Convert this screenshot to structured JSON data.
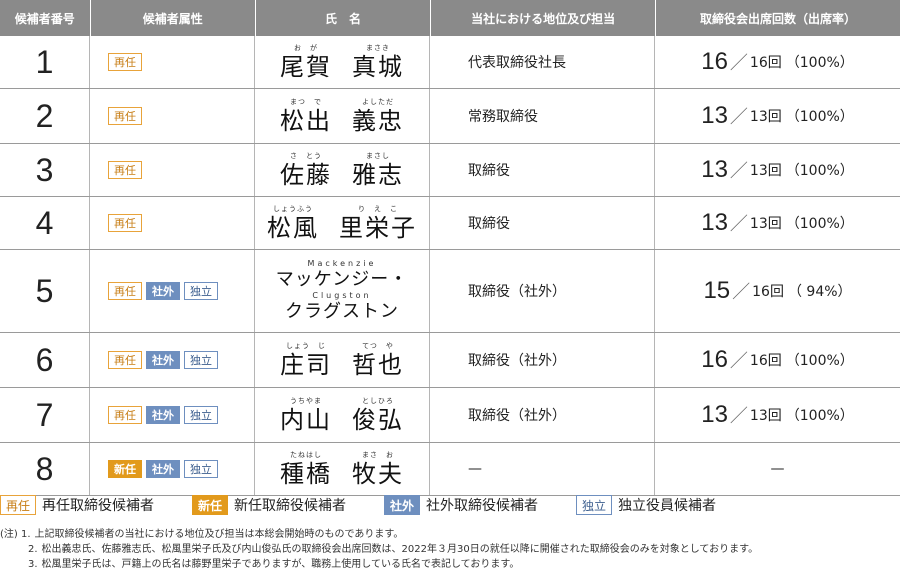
{
  "headers": [
    "候補者番号",
    "候補者属性",
    "氏　名",
    "当社における地位及び担当",
    "取締役会出席回数（出席率）"
  ],
  "candidates": [
    {
      "num": "1",
      "badges": [
        {
          "label": "再任",
          "kind": "reelect"
        }
      ],
      "ruby1": "お　が",
      "kanji1": "尾賀",
      "ruby2": "まさき",
      "kanji2": "真城",
      "position": "代表取締役社長",
      "att_a": "16",
      "att_b": "16回",
      "att_rate": "（100%）"
    },
    {
      "num": "2",
      "badges": [
        {
          "label": "再任",
          "kind": "reelect"
        }
      ],
      "ruby1": "まつ　で",
      "kanji1": "松出",
      "ruby2": "よしただ",
      "kanji2": "義忠",
      "position": "常務取締役",
      "att_a": "13",
      "att_b": "13回",
      "att_rate": "（100%）"
    },
    {
      "num": "3",
      "badges": [
        {
          "label": "再任",
          "kind": "reelect"
        }
      ],
      "ruby1": "さ　とう",
      "kanji1": "佐藤",
      "ruby2": "まさし",
      "kanji2": "雅志",
      "position": "取締役",
      "att_a": "13",
      "att_b": "13回",
      "att_rate": "（100%）"
    },
    {
      "num": "4",
      "badges": [
        {
          "label": "再任",
          "kind": "reelect"
        }
      ],
      "ruby1": "しょうふう",
      "kanji1": "松風",
      "ruby2": "り　え　こ",
      "kanji2": "里栄子",
      "position": "取締役",
      "att_a": "13",
      "att_b": "13回",
      "att_rate": "（100%）"
    },
    {
      "num": "5",
      "badges": [
        {
          "label": "再任",
          "kind": "reelect"
        },
        {
          "label": "社外",
          "kind": "outside"
        },
        {
          "label": "独立",
          "kind": "indep"
        }
      ],
      "ruby1": "Mackenzie",
      "kanji1": "マッケンジー・",
      "ruby2": "Clugston",
      "kanji2": "クラグストン",
      "position": "取締役（社外）",
      "att_a": "15",
      "att_b": "16回",
      "att_rate": "（ 94%）",
      "multiline": true
    },
    {
      "num": "6",
      "badges": [
        {
          "label": "再任",
          "kind": "reelect"
        },
        {
          "label": "社外",
          "kind": "outside"
        },
        {
          "label": "独立",
          "kind": "indep"
        }
      ],
      "ruby1": "しょう　じ",
      "kanji1": "庄司",
      "ruby2": "てつ　や",
      "kanji2": "哲也",
      "position": "取締役（社外）",
      "att_a": "16",
      "att_b": "16回",
      "att_rate": "（100%）"
    },
    {
      "num": "7",
      "badges": [
        {
          "label": "再任",
          "kind": "reelect"
        },
        {
          "label": "社外",
          "kind": "outside"
        },
        {
          "label": "独立",
          "kind": "indep"
        }
      ],
      "ruby1": "うちやま",
      "kanji1": "内山",
      "ruby2": "としひろ",
      "kanji2": "俊弘",
      "position": "取締役（社外）",
      "att_a": "13",
      "att_b": "13回",
      "att_rate": "（100%）"
    },
    {
      "num": "8",
      "badges": [
        {
          "label": "新任",
          "kind": "new"
        },
        {
          "label": "社外",
          "kind": "outside"
        },
        {
          "label": "独立",
          "kind": "indep"
        }
      ],
      "ruby1": "たねはし",
      "kanji1": "種橋",
      "ruby2": "まさ　お",
      "kanji2": "牧夫",
      "position": "—",
      "att_dash": "—"
    }
  ],
  "legend": [
    {
      "badge": "再任",
      "kind": "reelect",
      "text": "再任取締役候補者"
    },
    {
      "badge": "新任",
      "kind": "new",
      "text": "新任取締役候補者"
    },
    {
      "badge": "社外",
      "kind": "outside",
      "text": "社外取締役候補者"
    },
    {
      "badge": "独立",
      "kind": "indep",
      "text": "独立役員候補者"
    }
  ],
  "notes": [
    {
      "prefix": "(注) 1.",
      "text": "上記取締役候補者の当社における地位及び担当は本総会開始時のものであります。"
    },
    {
      "prefix": "2.",
      "text": "松出義忠氏、佐藤雅志氏、松風里栄子氏及び内山俊弘氏の取締役会出席回数は、2022年３月30日の就任以降に開催された取締役会のみを対象としております。"
    },
    {
      "prefix": "3.",
      "text": "松風里栄子氏は、戸籍上の氏名は藤野里栄子でありますが、職務上使用している氏名で表記しております。"
    }
  ]
}
